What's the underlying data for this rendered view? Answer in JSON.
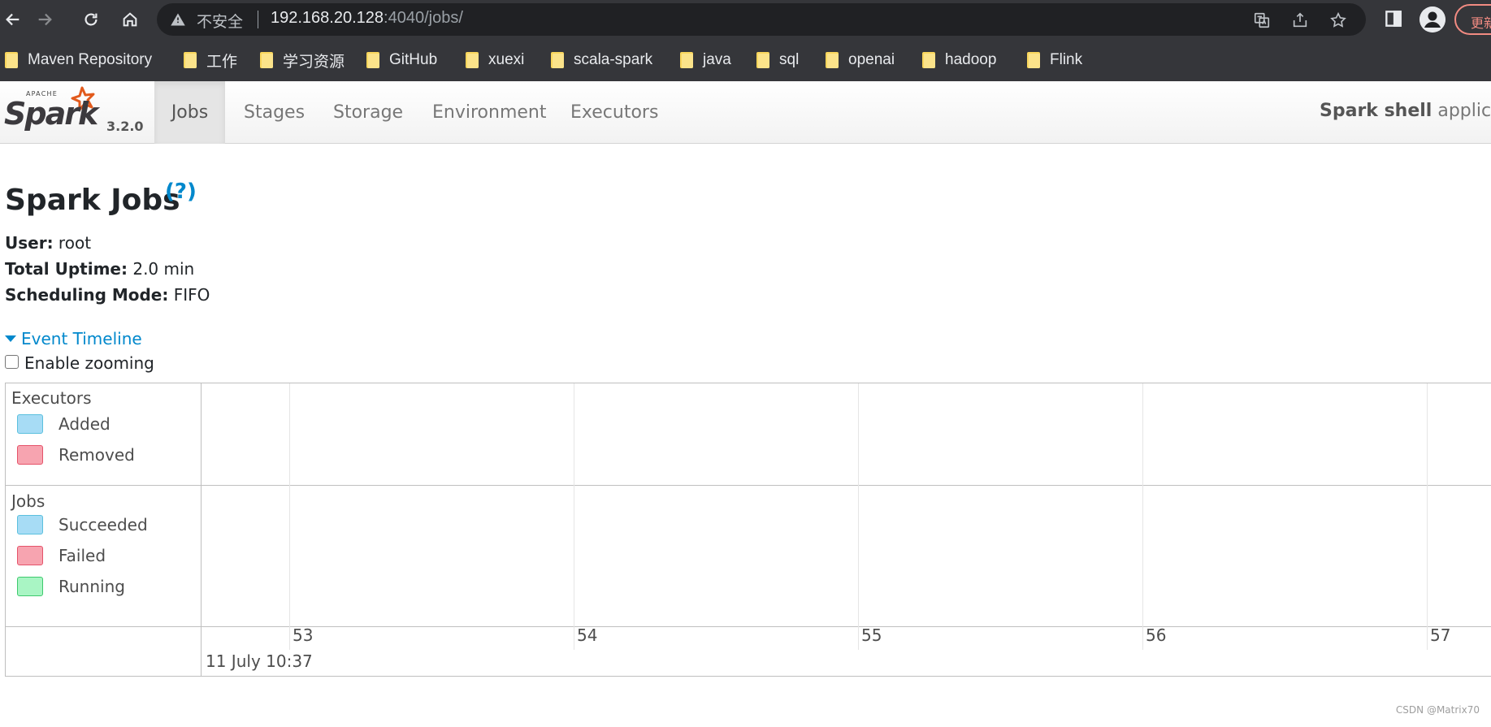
{
  "browser": {
    "insecure_label": "不安全",
    "url_host": "192.168.20.128",
    "url_path": ":4040/jobs/",
    "update_label": "更新",
    "bookmarks": [
      {
        "label": "Maven Repository"
      },
      {
        "label": "工作"
      },
      {
        "label": "学习资源"
      },
      {
        "label": "GitHub"
      },
      {
        "label": "xuexi"
      },
      {
        "label": "scala-spark"
      },
      {
        "label": "java"
      },
      {
        "label": "sql"
      },
      {
        "label": "openai"
      },
      {
        "label": "hadoop"
      },
      {
        "label": "Flink"
      }
    ]
  },
  "spark": {
    "logo_apache": "APACHE",
    "logo_spark": "Spark",
    "version": "3.2.0",
    "tabs": [
      {
        "label": "Jobs",
        "active": true
      },
      {
        "label": "Stages"
      },
      {
        "label": "Storage"
      },
      {
        "label": "Environment"
      },
      {
        "label": "Executors"
      }
    ],
    "app_name_bold": "Spark shell",
    "app_name_rest": " application UI"
  },
  "page": {
    "title": "Spark Jobs",
    "help": "(?)",
    "user_label": "User:",
    "user_value": " root",
    "uptime_label": "Total Uptime:",
    "uptime_value": " 2.0 min",
    "mode_label": "Scheduling Mode:",
    "mode_value": " FIFO",
    "event_timeline": "Event Timeline",
    "enable_zooming": "Enable zooming"
  },
  "timeline": {
    "executors_title": "Executors",
    "executors_legend": [
      {
        "label": "Added",
        "fill": "#a7dcf5",
        "border": "#5bc0de"
      },
      {
        "label": "Removed",
        "fill": "#f7a4b0",
        "border": "#e5536a"
      }
    ],
    "jobs_title": "Jobs",
    "jobs_legend": [
      {
        "label": "Succeeded",
        "fill": "#a7dcf5",
        "border": "#5bc0de"
      },
      {
        "label": "Failed",
        "fill": "#f7a4b0",
        "border": "#e5536a"
      },
      {
        "label": "Running",
        "fill": "#a9f5c4",
        "border": "#3ec96d"
      }
    ],
    "ticks": [
      "53",
      "54",
      "55",
      "56",
      "57"
    ],
    "major_label": "11 July 10:37"
  },
  "watermark": "CSDN @Matrix70"
}
